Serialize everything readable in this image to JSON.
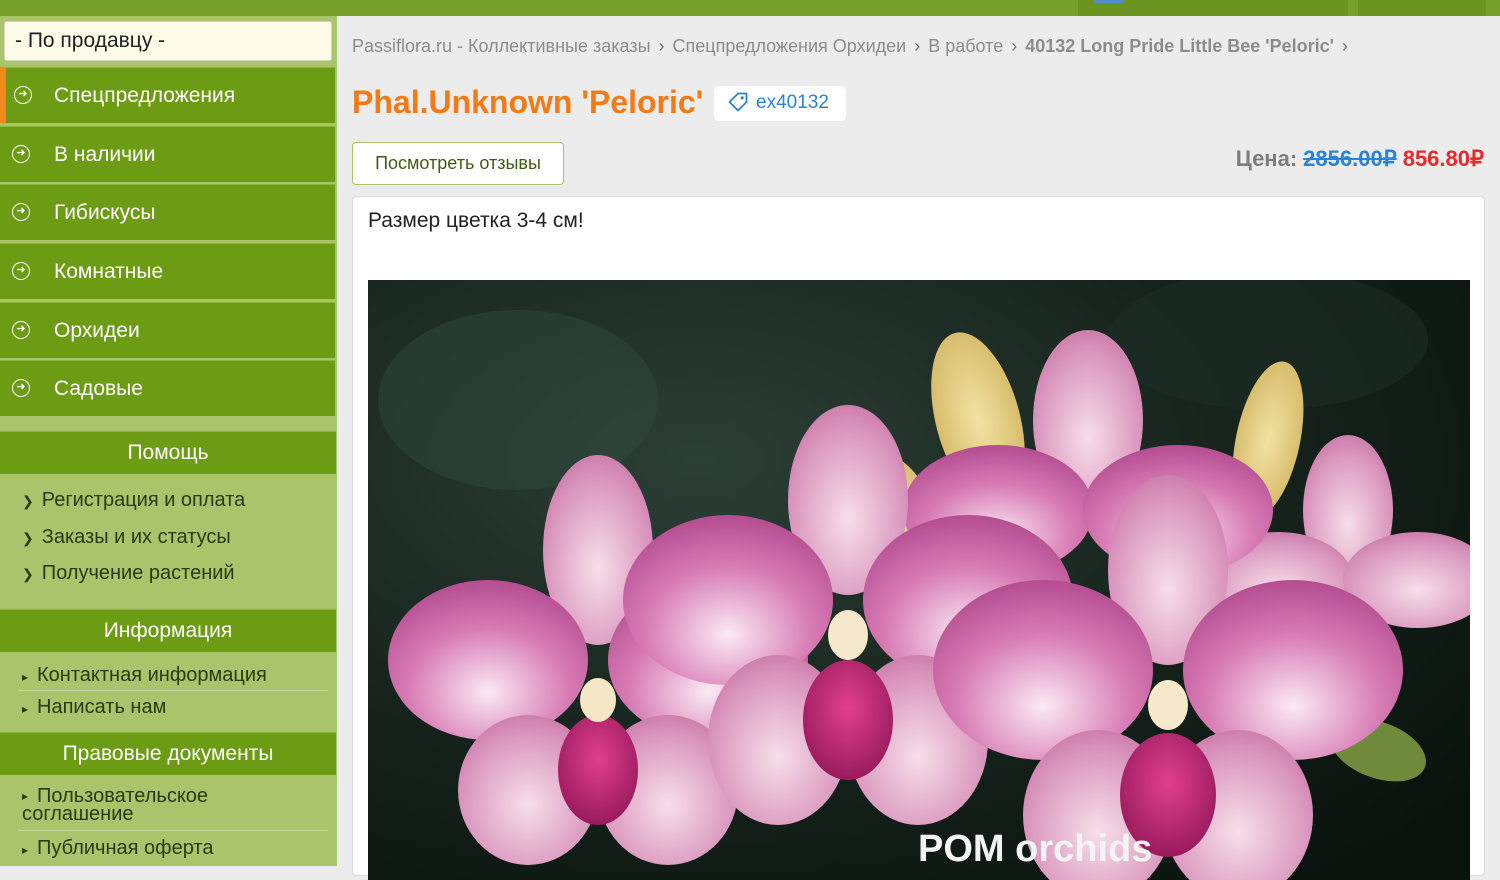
{
  "sidebar": {
    "seller_select": "- По продавцу -",
    "menu": [
      {
        "label": "Спецпредложения",
        "active": true
      },
      {
        "label": "В наличии",
        "active": false
      },
      {
        "label": "Гибискусы",
        "active": false
      },
      {
        "label": "Комнатные",
        "active": false
      },
      {
        "label": "Орхидеи",
        "active": false
      },
      {
        "label": "Садовые",
        "active": false
      }
    ],
    "help": {
      "title": "Помощь",
      "links": [
        "Регистрация и оплата",
        "Заказы и их статусы",
        "Получение растений"
      ]
    },
    "info": {
      "title": "Информация",
      "links": [
        "Контактная информация",
        "Написать нам"
      ]
    },
    "legal": {
      "title": "Правовые документы",
      "links": [
        "Пользовательское соглашение",
        "Публичная оферта"
      ]
    }
  },
  "breadcrumb": [
    "Passiflora.ru - Коллективные заказы",
    "Спецпредложения Орхидеи",
    "В работе",
    "40132 Long Pride Little Bee 'Peloric'"
  ],
  "product": {
    "title": "Phal.Unknown 'Peloric'",
    "tag": "ex40132",
    "reviews_button": "Посмотреть отзывы",
    "price_label": "Цена:",
    "old_price": "2856.00₽",
    "new_price": "856.80₽",
    "description": "Размер цветка 3-4 см!",
    "photo_watermark": "POM orchids"
  },
  "colors": {
    "menu_green": "#6b9c14",
    "sidebar_bg": "#a9c46a",
    "title_orange": "#f47a17",
    "old_price_blue": "#2a84d6",
    "new_price_red": "#e62b2b"
  }
}
